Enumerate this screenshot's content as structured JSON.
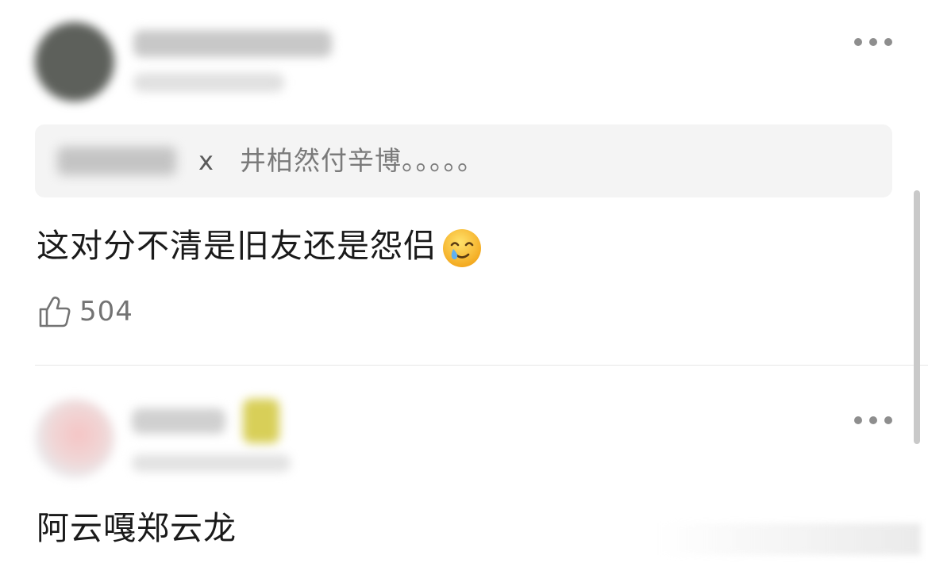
{
  "comments": [
    {
      "quote": {
        "separator": "x",
        "text": "井柏然付辛博。。。。。"
      },
      "text": "这对分不清是旧友还是怨侣",
      "emoji": "crying-smile-emoji",
      "likes": "504"
    },
    {
      "text": "阿云嘎郑云龙"
    }
  ],
  "colors": {
    "background": "#ffffff",
    "quote_background": "#f4f4f4",
    "primary_text": "#1a1a1a",
    "secondary_text": "#7a7a7a",
    "icon": "#8e8e8e"
  }
}
